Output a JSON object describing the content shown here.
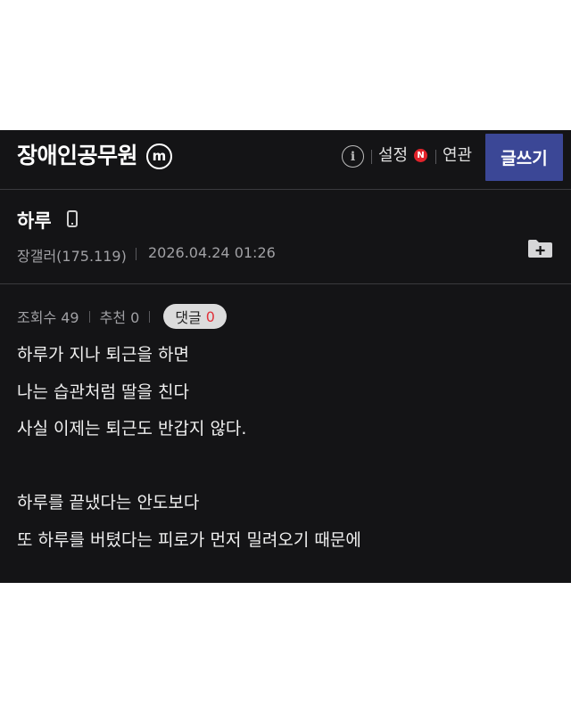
{
  "header": {
    "gallery_title": "장애인공무원",
    "minor_badge": "m",
    "info_icon": "i",
    "settings_label": "설정",
    "new_badge": "N",
    "related_label": "연관",
    "write_label": "글쓰기"
  },
  "post": {
    "title": "하루",
    "author": "장갤러(175.119)",
    "date": "2026.04.24 01:26",
    "views_label": "조회수 49",
    "recommend_label": "추천 0",
    "comments_label": "댓글",
    "comments_count": "0",
    "body_lines": [
      "하루가 지나 퇴근을 하면",
      "나는 습관처럼 딸을 친다",
      "사실 이제는 퇴근도 반갑지 않다.",
      "",
      "하루를 끝냈다는 안도보다",
      "또 하루를 버텼다는 피로가 먼저 밀려오기 때문에"
    ]
  },
  "icons": [
    "minor-gallery-badge-icon",
    "info-icon",
    "new-badge-icon",
    "mobile-phone-icon",
    "folder-add-icon"
  ],
  "colors": {
    "background": "#141416",
    "write_button": "#3b4796",
    "new_badge": "#e2232b",
    "comment_count": "#e0323a",
    "comment_pill": "#dcdcdc"
  }
}
